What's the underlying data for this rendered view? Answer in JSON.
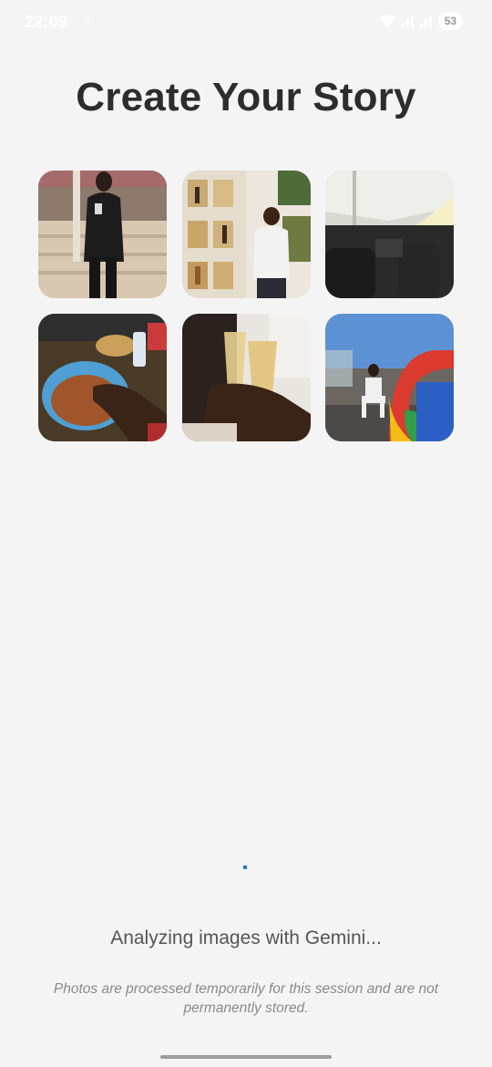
{
  "status_bar": {
    "time": "22:09",
    "notification_glyph": "ꟻ",
    "battery": "53",
    "icons": [
      "wifi-icon",
      "signal-icon",
      "signal-icon",
      "battery-icon"
    ]
  },
  "page": {
    "title": "Create Your Story"
  },
  "photos": [
    {
      "subject": "person-selfie-mirror"
    },
    {
      "subject": "person-by-shelves"
    },
    {
      "subject": "airplane-cabin"
    },
    {
      "subject": "food-bowl"
    },
    {
      "subject": "glasses-toast"
    },
    {
      "subject": "person-by-google-logo"
    }
  ],
  "progress": {
    "message": "Analyzing images with Gemini...",
    "disclaimer": "Photos are processed temporarily for this session and are not permanently stored."
  },
  "colors": {
    "background": "#f4f4f4",
    "title": "#2d2d2d",
    "message": "#555555",
    "disclaimer": "#8a8a8a",
    "spinner": "#2f6fc9"
  }
}
